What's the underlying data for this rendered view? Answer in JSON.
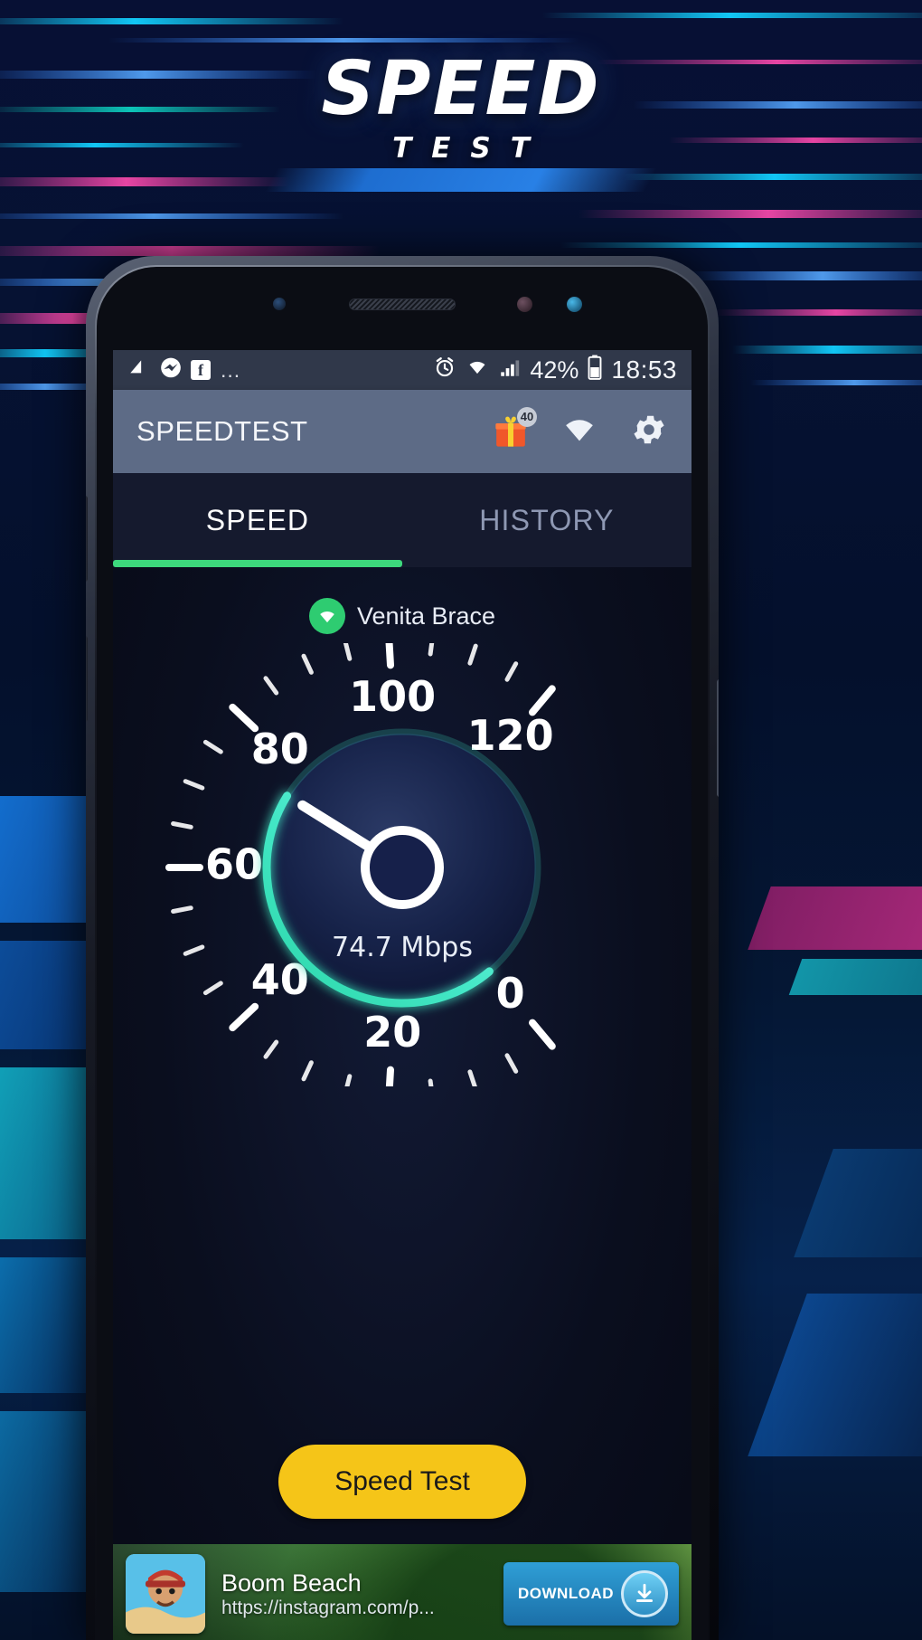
{
  "hero": {
    "logo_main": "SPEED",
    "logo_sub": "TEST"
  },
  "status_bar": {
    "notif_dots": "...",
    "battery_percent": "42%",
    "time": "18:53",
    "icons": [
      "gmail-icon",
      "messenger-icon",
      "facebook-icon",
      "alarm-icon",
      "wifi-icon",
      "signal-icon",
      "battery-icon"
    ]
  },
  "app_bar": {
    "title": "SPEEDTEST",
    "gift_badge": "40"
  },
  "tabs": {
    "items": [
      {
        "label": "SPEED",
        "active": true
      },
      {
        "label": "HISTORY",
        "active": false
      }
    ],
    "underline_color": "#3dd87c"
  },
  "network": {
    "name": "Venita Brace",
    "status_color": "#2ecc71"
  },
  "gauge": {
    "value_label": "74.7 Mbps",
    "value": 74.7,
    "min": 0,
    "max": 120,
    "tick_labels": [
      "0",
      "20",
      "40",
      "60",
      "80",
      "100",
      "120"
    ],
    "arc_color": "#3fe0c0",
    "needle_color": "#ffffff"
  },
  "actions": {
    "speed_test_button": "Speed Test",
    "button_color": "#f5c518"
  },
  "ad": {
    "title": "Boom Beach",
    "url": "https://instagram.com/p...",
    "cta": "DOWNLOAD"
  },
  "chart_data": {
    "type": "gauge",
    "title": "Speed Test",
    "unit": "Mbps",
    "value": 74.7,
    "min": 0,
    "max": 120,
    "ticks": [
      0,
      20,
      40,
      60,
      80,
      100,
      120
    ],
    "ylabel": "Mbps"
  }
}
